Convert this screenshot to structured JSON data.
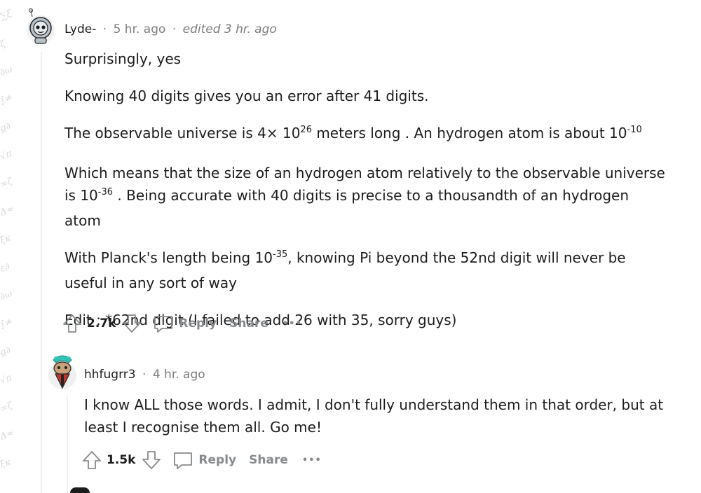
{
  "comment1": {
    "author": "Lyde-",
    "sep1": "·",
    "time": "5 hr. ago",
    "sep2": "·",
    "edited": "edited 3 hr. ago",
    "p1": "Surprisingly, yes",
    "p2": "Knowing 40 digits gives you an error after 41 digits.",
    "p3_a": "The observable universe is 4× 10",
    "p3_exp1": "26",
    "p3_b": " meters long . An hydrogen atom is about 10",
    "p3_exp2": "-10",
    "p4_a": "Which means that the size of an hydrogen atom relatively to the observable universe is 10",
    "p4_exp": "-36",
    "p4_b": " . Being accurate with 40 digits is precise to a thousandth of an hydrogen atom",
    "p5_a": "With Planck's length being 10",
    "p5_exp": "-35",
    "p5_b": ", knowing Pi beyond the 52nd digit will never be useful in any sort of way",
    "p6": "Edit : *62nd digit (I failed to add 26 with 35, sorry guys)",
    "score": "2.7k",
    "reply_label": "Reply",
    "share_label": "Share",
    "more_label": "•••"
  },
  "comment2": {
    "author": "hhfugrr3",
    "sep1": "·",
    "time": "4 hr. ago",
    "text": "I know ALL those words. I admit, I don't fully understand them in that order, but at least I recognise them all. Go me!",
    "score": "1.5k",
    "reply_label": "Reply",
    "share_label": "Share",
    "more_label": "•••"
  },
  "colors": {
    "text": "#1c1c1c",
    "meta": "#7c7c7c",
    "action": "#878a8c",
    "thread_line": "#edeff1"
  },
  "icons": [
    "upvote-icon",
    "downvote-icon",
    "reply-bubble-icon",
    "more-options-icon"
  ]
}
